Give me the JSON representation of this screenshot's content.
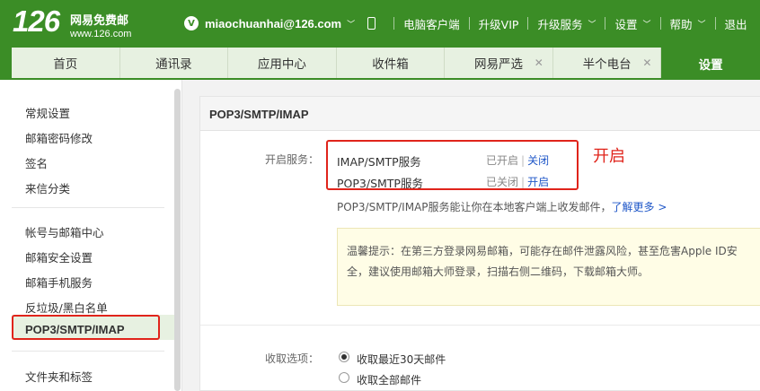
{
  "logo": {
    "number": "126",
    "name": "网易免费邮",
    "domain": "www.126.com"
  },
  "topbar": {
    "avatar_letter": "V",
    "email": "miaochuanhai@126.com",
    "links": [
      "电脑客户端",
      "升级VIP",
      "升级服务",
      "设置",
      "帮助",
      "退出"
    ]
  },
  "tabs": [
    {
      "label": "首页",
      "closable": false,
      "active": false
    },
    {
      "label": "通讯录",
      "closable": false,
      "active": false
    },
    {
      "label": "应用中心",
      "closable": false,
      "active": false
    },
    {
      "label": "收件箱",
      "closable": false,
      "active": false
    },
    {
      "label": "网易严选",
      "closable": true,
      "active": false
    },
    {
      "label": "半个电台",
      "closable": true,
      "active": false
    },
    {
      "label": "设置",
      "closable": false,
      "active": true
    }
  ],
  "sidebar": {
    "group1": [
      "常规设置",
      "邮箱密码修改",
      "签名",
      "来信分类"
    ],
    "group2": [
      "帐号与邮箱中心",
      "邮箱安全设置",
      "邮箱手机服务",
      "反垃圾/黑白名单",
      "POP3/SMTP/IMAP"
    ],
    "group3": [
      "文件夹和标签"
    ],
    "active": "POP3/SMTP/IMAP"
  },
  "main": {
    "title": "POP3/SMTP/IMAP",
    "service_label": "开启服务：",
    "services": [
      {
        "name": "IMAP/SMTP服务",
        "status": "已开启",
        "action": "关闭"
      },
      {
        "name": "POP3/SMTP服务",
        "status": "已关闭",
        "action": "开启"
      }
    ],
    "callout": "开启",
    "description": "POP3/SMTP/IMAP服务能让你在本地客户端上收发邮件，",
    "learn_more": "了解更多 >",
    "tip": "温馨提示：在第三方登录网易邮箱，可能存在邮件泄露风险，甚至危害Apple ID安全，建议使用邮箱大师登录，扫描右侧二维码，下载邮箱大师。",
    "fetch_label": "收取选项：",
    "fetch_options": [
      {
        "label": "收取最近30天邮件",
        "selected": true
      },
      {
        "label": "收取全部邮件",
        "selected": false
      }
    ]
  }
}
